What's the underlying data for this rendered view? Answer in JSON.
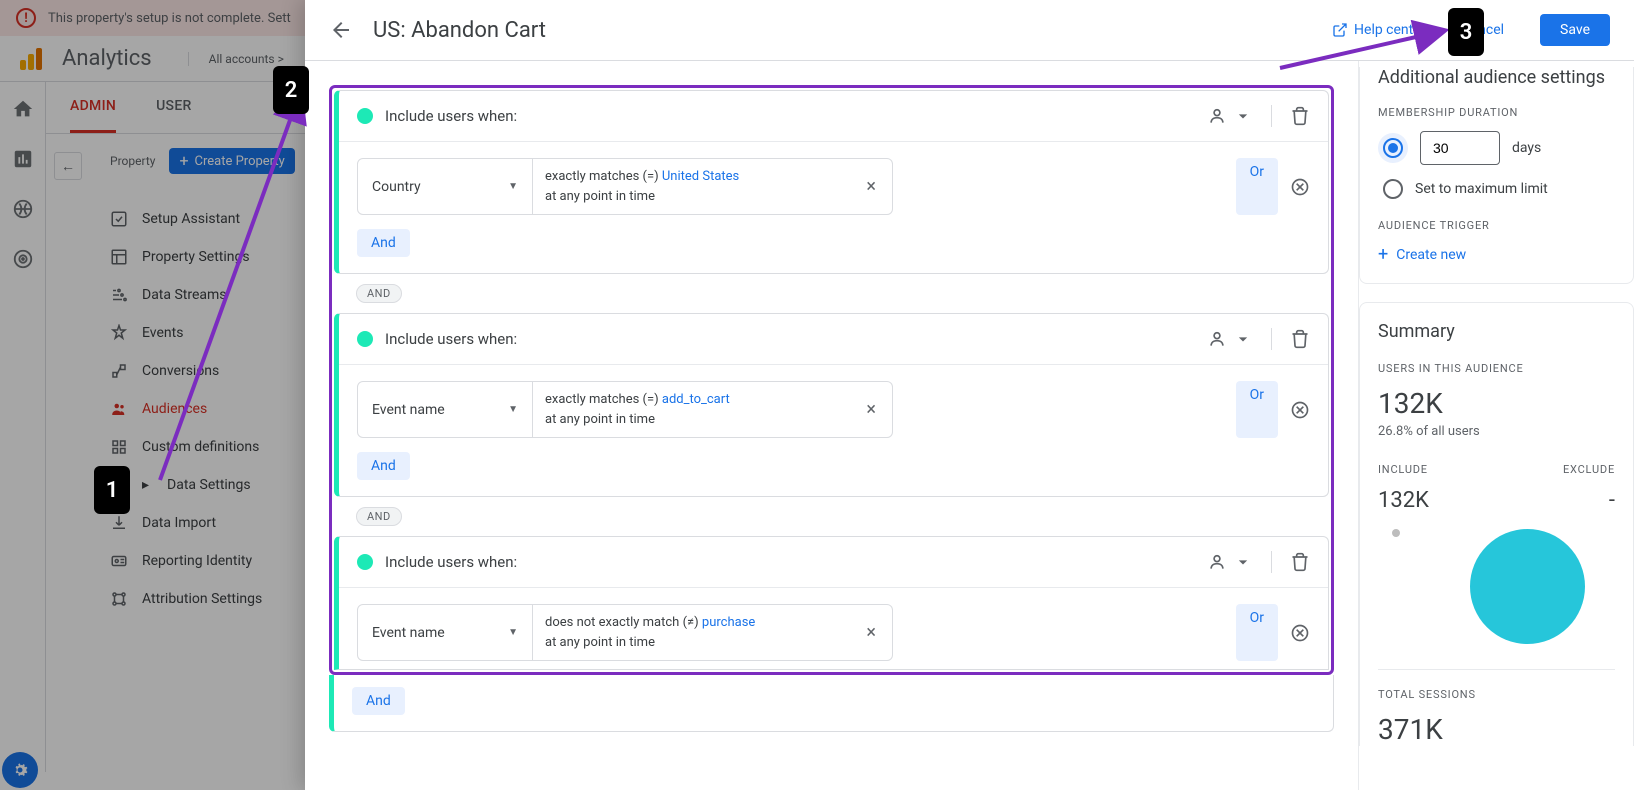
{
  "warning": {
    "text": "This property's setup is not complete. Sett"
  },
  "app": {
    "title": "Analytics",
    "accounts": "All accounts >"
  },
  "tabs": {
    "admin": "ADMIN",
    "user": "USER"
  },
  "property": {
    "label": "Property",
    "create": "Create Property",
    "items": {
      "setup": "Setup Assistant",
      "settings": "Property Settings",
      "streams": "Data Streams",
      "events": "Events",
      "conversions": "Conversions",
      "audiences": "Audiences",
      "custom": "Custom definitions",
      "datasettings": "Data Settings",
      "import": "Data Import",
      "reporting": "Reporting Identity",
      "attribution": "Attribution Settings"
    }
  },
  "panel": {
    "title": "US: Abandon Cart",
    "help": "Help center",
    "cancel": "Cancel",
    "save": "Save"
  },
  "conditions": {
    "include": "Include users when:",
    "and": "And",
    "and_pill": "AND",
    "or": "Or",
    "c1": {
      "dim": "Country",
      "op": "exactly matches (=) ",
      "val": "United States",
      "time": "at any point in time"
    },
    "c2": {
      "dim": "Event name",
      "op": "exactly matches (=) ",
      "val": "add_to_cart",
      "time": "at any point in time"
    },
    "c3": {
      "dim": "Event name",
      "op": "does not exactly match (≠) ",
      "val": "purchase",
      "time": "at any point in time"
    }
  },
  "settings": {
    "title": "Additional audience settings",
    "duration_label": "Membership duration",
    "days_value": "30",
    "days_unit": "days",
    "max": "Set to maximum limit",
    "trigger_label": "Audience trigger",
    "create_new": "Create new"
  },
  "summary": {
    "title": "Summary",
    "users_label": "Users in this audience",
    "users": "132K",
    "users_pct": "26.8% of all users",
    "include_label": "Include",
    "include_val": "132K",
    "exclude_label": "Exclude",
    "exclude_val": "-",
    "sessions_label": "Total sessions",
    "sessions": "371K"
  },
  "callouts": {
    "b1": "1",
    "b2": "2",
    "b3": "3"
  }
}
